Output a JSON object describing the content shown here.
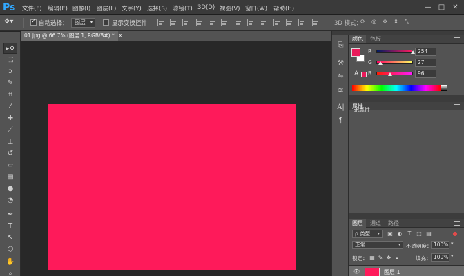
{
  "app": {
    "logo": "Ps"
  },
  "menu": [
    {
      "label": "文件(F)"
    },
    {
      "label": "编辑(E)"
    },
    {
      "label": "图像(I)"
    },
    {
      "label": "图层(L)"
    },
    {
      "label": "文字(Y)"
    },
    {
      "label": "选择(S)"
    },
    {
      "label": "滤镜(T)"
    },
    {
      "label": "3D(D)"
    },
    {
      "label": "视图(V)"
    },
    {
      "label": "窗口(W)"
    },
    {
      "label": "帮助(H)"
    }
  ],
  "window_controls": {
    "minimize": "—",
    "maximize": "□",
    "close": "✕"
  },
  "options_bar": {
    "auto_select_label": "自动选择：",
    "auto_select_checked": true,
    "layer_select_value": "图层",
    "show_transform_label": "显示变换控件",
    "show_transform_checked": false,
    "mode_3d_label": "3D 模式："
  },
  "document": {
    "tab_title": "01.jpg @ 66.7% (图层 1, RGB/8#) *",
    "tab_close": "×",
    "fill_color": "#fe1a5a"
  },
  "color_panel": {
    "tabs": [
      {
        "label": "颜色"
      },
      {
        "label": "色板"
      }
    ],
    "foreground": "#ea1a5a",
    "background": "#ffffff",
    "channels": [
      {
        "name": "R",
        "value": "254",
        "level": 0.996
      },
      {
        "name": "G",
        "value": "27",
        "level": 0.106
      },
      {
        "name": "B",
        "value": "96",
        "level": 0.376
      }
    ]
  },
  "properties_panel": {
    "title": "属性",
    "content": "无属性"
  },
  "layers_panel": {
    "tabs": [
      {
        "label": "图层"
      },
      {
        "label": "通道"
      },
      {
        "label": "路径"
      }
    ],
    "filter_label": "ρ 类型",
    "blend_mode": "正常",
    "opacity_label": "不透明度：",
    "opacity_value": "100%",
    "lock_label": "锁定：",
    "fill_label": "填充：",
    "fill_value": "100%",
    "layers": [
      {
        "name": "图层 1",
        "thumb_color": "#fe1a5a"
      }
    ]
  },
  "icons": {
    "toolbox": [
      "move-icon",
      "marquee-icon",
      "lasso-icon",
      "quick-select-icon",
      "crop-icon",
      "eyedropper-icon",
      "healing-icon",
      "brush-icon",
      "stamp-icon",
      "history-brush-icon",
      "eraser-icon",
      "gradient-icon",
      "blur-icon",
      "dodge-icon",
      "pen-icon",
      "type-icon",
      "path-select-icon",
      "shape-icon",
      "hand-icon",
      "zoom-icon"
    ]
  }
}
